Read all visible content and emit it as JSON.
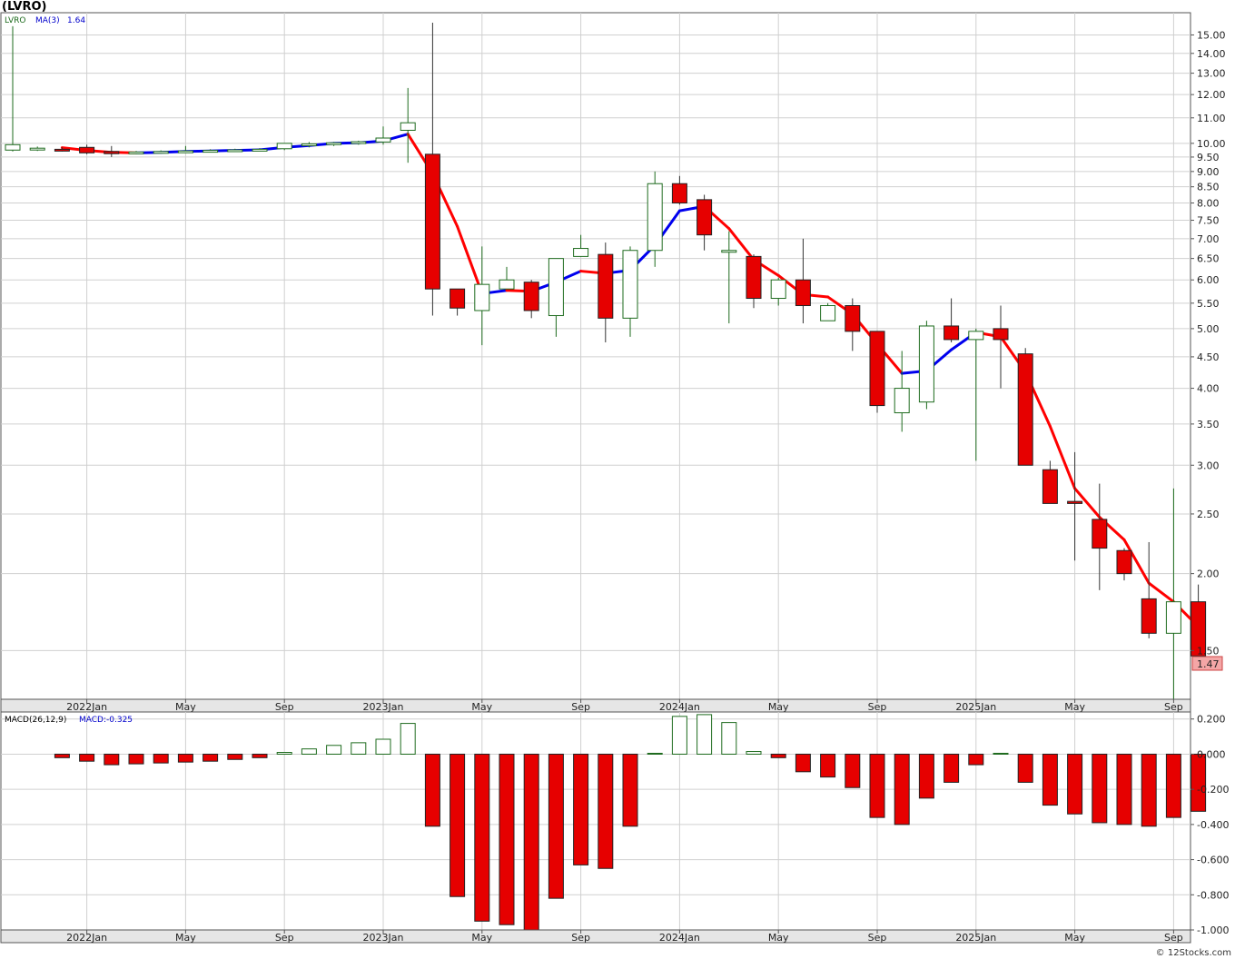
{
  "header": {
    "symbol": "(LVRO)",
    "price_legend": "LVRO",
    "ma_legend": "MA(3)",
    "ma_value": "1.64",
    "macd_params": "MACD(26,12,9)",
    "macd_legend": "MACD:-0.325",
    "last_price": "1.47",
    "watermark": "© 12Stocks.com"
  },
  "colors": {
    "up": "#1e6b1e",
    "down": "#e60000",
    "ma_down": "#ff0000",
    "ma_up": "#0000ee",
    "grid": "#d0d0d0",
    "last_price_bg": "#f4a6a6"
  },
  "chart_data": [
    {
      "type": "candlestick",
      "title": "(LVRO)",
      "scale": "log",
      "ylim": [
        1.25,
        16.3
      ],
      "y_ticks": [
        "15.00",
        "14.00",
        "13.00",
        "12.00",
        "11.00",
        "10.00",
        "9.50",
        "9.00",
        "8.50",
        "8.00",
        "7.50",
        "7.00",
        "6.50",
        "6.00",
        "5.50",
        "5.00",
        "4.50",
        "4.00",
        "3.50",
        "3.00",
        "2.50",
        "2.00",
        "1.50"
      ],
      "x_ticks": [
        "2022Jan",
        "May",
        "Sep",
        "2023Jan",
        "May",
        "Sep",
        "2024Jan",
        "May",
        "Sep",
        "2025Jan",
        "May",
        "Sep"
      ],
      "candles": [
        {
          "date": "2021-10",
          "o": 9.75,
          "h": 15.5,
          "l": 9.7,
          "c": 9.95
        },
        {
          "date": "2021-11",
          "o": 9.8,
          "h": 9.88,
          "l": 9.72,
          "c": 9.82
        },
        {
          "date": "2021-12",
          "o": 9.78,
          "h": 9.85,
          "l": 9.7,
          "c": 9.75
        },
        {
          "date": "2022-01",
          "o": 9.85,
          "h": 9.95,
          "l": 9.6,
          "c": 9.65
        },
        {
          "date": "2022-02",
          "o": 9.7,
          "h": 9.9,
          "l": 9.5,
          "c": 9.62
        },
        {
          "date": "2022-03",
          "o": 9.66,
          "h": 9.72,
          "l": 9.6,
          "c": 9.68
        },
        {
          "date": "2022-04",
          "o": 9.68,
          "h": 9.74,
          "l": 9.64,
          "c": 9.7
        },
        {
          "date": "2022-05",
          "o": 9.7,
          "h": 9.9,
          "l": 9.65,
          "c": 9.72
        },
        {
          "date": "2022-06",
          "o": 9.72,
          "h": 9.78,
          "l": 9.68,
          "c": 9.74
        },
        {
          "date": "2022-07",
          "o": 9.74,
          "h": 9.8,
          "l": 9.7,
          "c": 9.76
        },
        {
          "date": "2022-08",
          "o": 9.76,
          "h": 9.82,
          "l": 9.72,
          "c": 9.78
        },
        {
          "date": "2022-09",
          "o": 9.8,
          "h": 10.0,
          "l": 9.75,
          "c": 10.0
        },
        {
          "date": "2022-10",
          "o": 9.95,
          "h": 10.05,
          "l": 9.85,
          "c": 9.98
        },
        {
          "date": "2022-11",
          "o": 9.98,
          "h": 10.05,
          "l": 9.9,
          "c": 10.02
        },
        {
          "date": "2022-12",
          "o": 10.02,
          "h": 10.1,
          "l": 9.95,
          "c": 10.06
        },
        {
          "date": "2023-01",
          "o": 10.05,
          "h": 10.65,
          "l": 9.95,
          "c": 10.2
        },
        {
          "date": "2023-02",
          "o": 10.5,
          "h": 12.3,
          "l": 9.3,
          "c": 10.8
        },
        {
          "date": "2023-03",
          "o": 9.6,
          "h": 15.7,
          "l": 5.25,
          "c": 5.8
        },
        {
          "date": "2023-04",
          "o": 5.8,
          "h": 5.8,
          "l": 5.25,
          "c": 5.4
        },
        {
          "date": "2023-05",
          "o": 5.35,
          "h": 6.8,
          "l": 4.7,
          "c": 5.9
        },
        {
          "date": "2023-06",
          "o": 5.8,
          "h": 6.3,
          "l": 5.8,
          "c": 6.0
        },
        {
          "date": "2023-07",
          "o": 5.95,
          "h": 6.0,
          "l": 5.2,
          "c": 5.35
        },
        {
          "date": "2023-08",
          "o": 5.25,
          "h": 6.5,
          "l": 4.85,
          "c": 6.5
        },
        {
          "date": "2023-09",
          "o": 6.55,
          "h": 7.1,
          "l": 6.55,
          "c": 6.75
        },
        {
          "date": "2023-10",
          "o": 6.6,
          "h": 6.9,
          "l": 4.75,
          "c": 5.2
        },
        {
          "date": "2023-11",
          "o": 5.2,
          "h": 6.8,
          "l": 4.85,
          "c": 6.7
        },
        {
          "date": "2023-12",
          "o": 6.7,
          "h": 9.0,
          "l": 6.3,
          "c": 8.6
        },
        {
          "date": "2024-01",
          "o": 8.6,
          "h": 8.85,
          "l": 7.95,
          "c": 8.0
        },
        {
          "date": "2024-02",
          "o": 8.1,
          "h": 8.25,
          "l": 6.7,
          "c": 7.1
        },
        {
          "date": "2024-03",
          "o": 6.7,
          "h": 7.2,
          "l": 5.1,
          "c": 6.7
        },
        {
          "date": "2024-04",
          "o": 6.55,
          "h": 6.6,
          "l": 5.4,
          "c": 5.6
        },
        {
          "date": "2024-05",
          "o": 5.6,
          "h": 6.05,
          "l": 5.45,
          "c": 6.0
        },
        {
          "date": "2024-06",
          "o": 6.0,
          "h": 7.0,
          "l": 5.1,
          "c": 5.45
        },
        {
          "date": "2024-07",
          "o": 5.15,
          "h": 5.5,
          "l": 5.15,
          "c": 5.45
        },
        {
          "date": "2024-08",
          "o": 5.45,
          "h": 5.6,
          "l": 4.6,
          "c": 4.95
        },
        {
          "date": "2024-09",
          "o": 4.95,
          "h": 4.95,
          "l": 3.65,
          "c": 3.75
        },
        {
          "date": "2024-10",
          "o": 3.65,
          "h": 4.6,
          "l": 3.4,
          "c": 4.0
        },
        {
          "date": "2024-11",
          "o": 3.8,
          "h": 5.15,
          "l": 3.7,
          "c": 5.05
        },
        {
          "date": "2024-12",
          "o": 5.05,
          "h": 5.6,
          "l": 4.75,
          "c": 4.8
        },
        {
          "date": "2025-01",
          "o": 4.8,
          "h": 5.0,
          "l": 3.05,
          "c": 4.95
        },
        {
          "date": "2025-02",
          "o": 5.0,
          "h": 5.45,
          "l": 4.0,
          "c": 4.8
        },
        {
          "date": "2025-03",
          "o": 4.55,
          "h": 4.65,
          "l": 3.0,
          "c": 3.0
        },
        {
          "date": "2025-04",
          "o": 2.95,
          "h": 3.05,
          "l": 2.6,
          "c": 2.6
        },
        {
          "date": "2025-05",
          "o": 2.62,
          "h": 3.15,
          "l": 2.1,
          "c": 2.6
        },
        {
          "date": "2025-06",
          "o": 2.45,
          "h": 2.8,
          "l": 1.88,
          "c": 2.2
        },
        {
          "date": "2025-07",
          "o": 2.18,
          "h": 2.2,
          "l": 1.95,
          "c": 2.0
        },
        {
          "date": "2025-08",
          "o": 1.82,
          "h": 2.25,
          "l": 1.57,
          "c": 1.6
        },
        {
          "date": "2025-09",
          "o": 1.6,
          "h": 2.75,
          "l": 1.25,
          "c": 1.8
        },
        {
          "date": "2025-10",
          "o": 1.8,
          "h": 1.92,
          "l": 1.47,
          "c": 1.47
        }
      ],
      "ma3": [
        {
          "date": "2021-12",
          "v": 9.84
        },
        {
          "date": "2022-01",
          "v": 9.74
        },
        {
          "date": "2022-02",
          "v": 9.67
        },
        {
          "date": "2022-03",
          "v": 9.65
        },
        {
          "date": "2022-04",
          "v": 9.67
        },
        {
          "date": "2022-05",
          "v": 9.7
        },
        {
          "date": "2022-06",
          "v": 9.72
        },
        {
          "date": "2022-07",
          "v": 9.74
        },
        {
          "date": "2022-08",
          "v": 9.76
        },
        {
          "date": "2022-09",
          "v": 9.85
        },
        {
          "date": "2022-10",
          "v": 9.92
        },
        {
          "date": "2022-11",
          "v": 10.0
        },
        {
          "date": "2022-12",
          "v": 10.02
        },
        {
          "date": "2023-01",
          "v": 10.09
        },
        {
          "date": "2023-02",
          "v": 10.35
        },
        {
          "date": "2023-03",
          "v": 8.93
        },
        {
          "date": "2023-04",
          "v": 7.33
        },
        {
          "date": "2023-05",
          "v": 5.7
        },
        {
          "date": "2023-06",
          "v": 5.77
        },
        {
          "date": "2023-07",
          "v": 5.75
        },
        {
          "date": "2023-08",
          "v": 5.95
        },
        {
          "date": "2023-09",
          "v": 6.2
        },
        {
          "date": "2023-10",
          "v": 6.15
        },
        {
          "date": "2023-11",
          "v": 6.22
        },
        {
          "date": "2023-12",
          "v": 6.83
        },
        {
          "date": "2024-01",
          "v": 7.77
        },
        {
          "date": "2024-02",
          "v": 7.9
        },
        {
          "date": "2024-03",
          "v": 7.27
        },
        {
          "date": "2024-04",
          "v": 6.47
        },
        {
          "date": "2024-05",
          "v": 6.1
        },
        {
          "date": "2024-06",
          "v": 5.68
        },
        {
          "date": "2024-07",
          "v": 5.63
        },
        {
          "date": "2024-08",
          "v": 5.28
        },
        {
          "date": "2024-09",
          "v": 4.72
        },
        {
          "date": "2024-10",
          "v": 4.23
        },
        {
          "date": "2024-11",
          "v": 4.27
        },
        {
          "date": "2024-12",
          "v": 4.62
        },
        {
          "date": "2025-01",
          "v": 4.93
        },
        {
          "date": "2025-02",
          "v": 4.85
        },
        {
          "date": "2025-03",
          "v": 4.25
        },
        {
          "date": "2025-04",
          "v": 3.47
        },
        {
          "date": "2025-05",
          "v": 2.75
        },
        {
          "date": "2025-06",
          "v": 2.47
        },
        {
          "date": "2025-07",
          "v": 2.27
        },
        {
          "date": "2025-08",
          "v": 1.93
        },
        {
          "date": "2025-09",
          "v": 1.8
        },
        {
          "date": "2025-10",
          "v": 1.64
        }
      ]
    },
    {
      "type": "bar",
      "title": "MACD(26,12,9)",
      "ylim": [
        -1.0,
        0.24
      ],
      "y_ticks": [
        "0.200",
        "0.000",
        "-0.200",
        "-0.400",
        "-0.600",
        "-0.800",
        "-1.000"
      ],
      "x_ticks": [
        "2022Jan",
        "May",
        "Sep",
        "2023Jan",
        "May",
        "Sep",
        "2024Jan",
        "May",
        "Sep",
        "2025Jan",
        "May",
        "Sep"
      ],
      "bars": [
        {
          "date": "2021-12",
          "v": -0.02
        },
        {
          "date": "2022-01",
          "v": -0.04
        },
        {
          "date": "2022-02",
          "v": -0.06
        },
        {
          "date": "2022-03",
          "v": -0.055
        },
        {
          "date": "2022-04",
          "v": -0.05
        },
        {
          "date": "2022-05",
          "v": -0.045
        },
        {
          "date": "2022-06",
          "v": -0.04
        },
        {
          "date": "2022-07",
          "v": -0.03
        },
        {
          "date": "2022-08",
          "v": -0.02
        },
        {
          "date": "2022-09",
          "v": 0.01
        },
        {
          "date": "2022-10",
          "v": 0.03
        },
        {
          "date": "2022-11",
          "v": 0.05
        },
        {
          "date": "2022-12",
          "v": 0.065
        },
        {
          "date": "2023-01",
          "v": 0.085
        },
        {
          "date": "2023-02",
          "v": 0.175
        },
        {
          "date": "2023-03",
          "v": -0.41
        },
        {
          "date": "2023-04",
          "v": -0.81
        },
        {
          "date": "2023-05",
          "v": -0.95
        },
        {
          "date": "2023-06",
          "v": -0.97
        },
        {
          "date": "2023-07",
          "v": -1.0
        },
        {
          "date": "2023-08",
          "v": -0.82
        },
        {
          "date": "2023-09",
          "v": -0.63
        },
        {
          "date": "2023-10",
          "v": -0.65
        },
        {
          "date": "2023-11",
          "v": -0.41
        },
        {
          "date": "2023-12",
          "v": 0.005
        },
        {
          "date": "2024-01",
          "v": 0.215
        },
        {
          "date": "2024-02",
          "v": 0.225
        },
        {
          "date": "2024-03",
          "v": 0.18
        },
        {
          "date": "2024-04",
          "v": 0.015
        },
        {
          "date": "2024-05",
          "v": -0.02
        },
        {
          "date": "2024-06",
          "v": -0.1
        },
        {
          "date": "2024-07",
          "v": -0.13
        },
        {
          "date": "2024-08",
          "v": -0.19
        },
        {
          "date": "2024-09",
          "v": -0.36
        },
        {
          "date": "2024-10",
          "v": -0.4
        },
        {
          "date": "2024-11",
          "v": -0.25
        },
        {
          "date": "2024-12",
          "v": -0.16
        },
        {
          "date": "2025-01",
          "v": -0.06
        },
        {
          "date": "2025-02",
          "v": 0.005
        },
        {
          "date": "2025-03",
          "v": -0.16
        },
        {
          "date": "2025-04",
          "v": -0.29
        },
        {
          "date": "2025-05",
          "v": -0.34
        },
        {
          "date": "2025-06",
          "v": -0.39
        },
        {
          "date": "2025-07",
          "v": -0.4
        },
        {
          "date": "2025-08",
          "v": -0.41
        },
        {
          "date": "2025-09",
          "v": -0.36
        },
        {
          "date": "2025-10",
          "v": -0.325
        }
      ]
    }
  ]
}
